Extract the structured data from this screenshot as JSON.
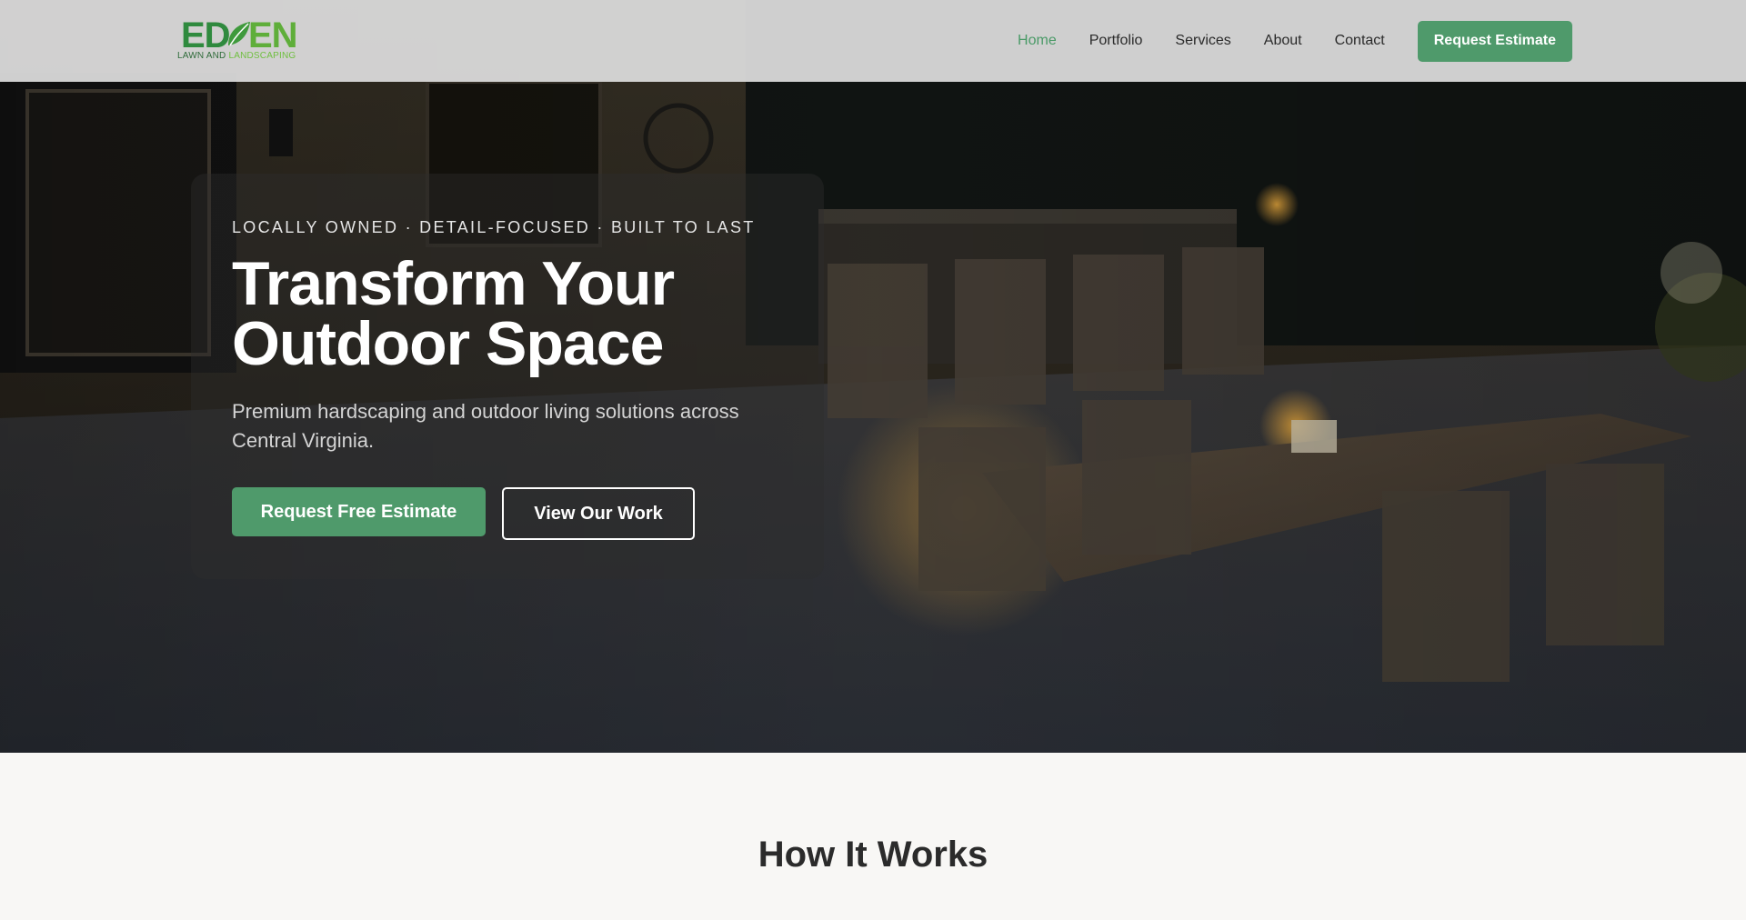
{
  "header": {
    "logo": {
      "wordmark": "EDEN",
      "tagline_part1": "LAWN AND",
      "tagline_part2": "LANDSCAPING"
    },
    "nav": [
      {
        "label": "Home",
        "active": true
      },
      {
        "label": "Portfolio",
        "active": false
      },
      {
        "label": "Services",
        "active": false
      },
      {
        "label": "About",
        "active": false
      },
      {
        "label": "Contact",
        "active": false
      }
    ],
    "cta_label": "Request Estimate"
  },
  "hero": {
    "eyebrow": "LOCALLY OWNED · DETAIL-FOCUSED · BUILT TO LAST",
    "title_line1": "Transform Your",
    "title_line2": "Outdoor Space",
    "subtitle": "Premium hardscaping and outdoor living solutions across Central Virginia.",
    "primary_button": "Request Free Estimate",
    "secondary_button": "View Our Work"
  },
  "how_it_works": {
    "title": "How It Works"
  },
  "colors": {
    "accent_green": "#4f9a6b",
    "logo_dark_green": "#2f6b3a",
    "logo_light_green": "#6fbf3f",
    "header_bg": "#dedede",
    "page_bg": "#f8f7f5"
  }
}
